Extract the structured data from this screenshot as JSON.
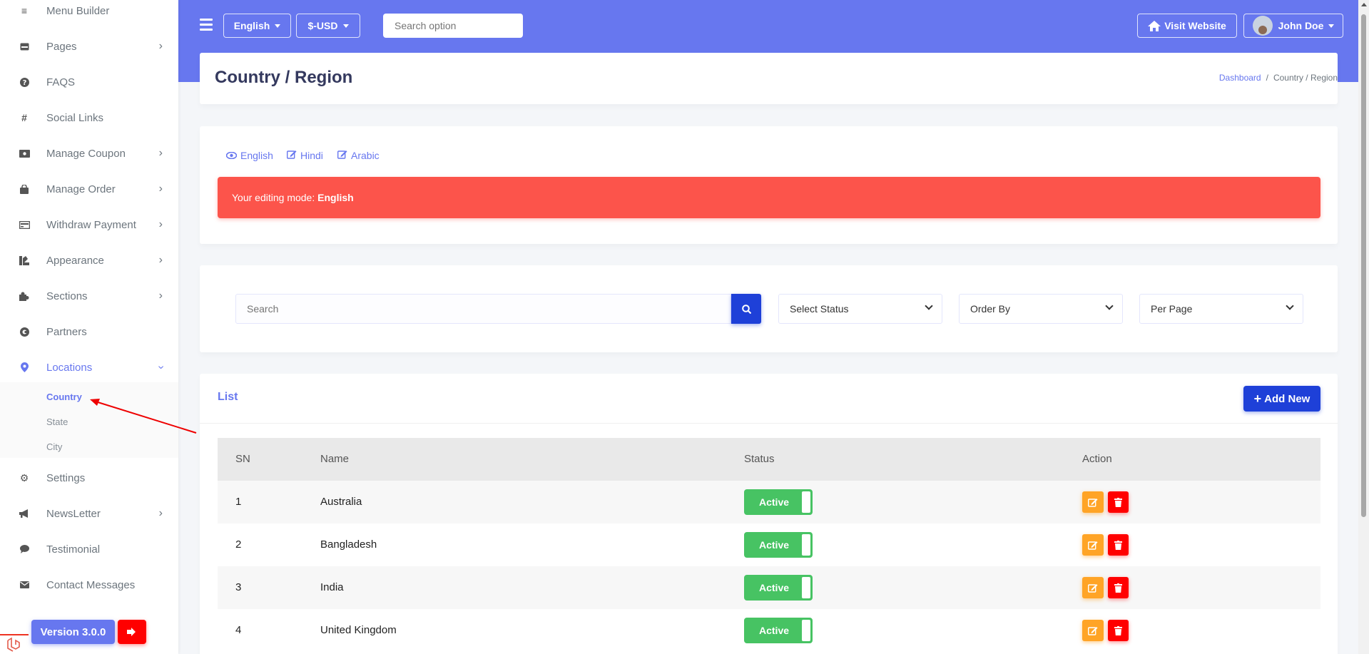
{
  "sidebar": {
    "items": [
      {
        "label": "Menu Builder",
        "icon": "bars-icon",
        "chevron": false
      },
      {
        "label": "Pages",
        "icon": "page-icon",
        "chevron": true
      },
      {
        "label": "FAQS",
        "icon": "question-icon",
        "chevron": false
      },
      {
        "label": "Social Links",
        "icon": "hashtag-icon",
        "chevron": false
      },
      {
        "label": "Manage Coupon",
        "icon": "ticket-icon",
        "chevron": true
      },
      {
        "label": "Manage Order",
        "icon": "bag-icon",
        "chevron": true
      },
      {
        "label": "Withdraw Payment",
        "icon": "card-icon",
        "chevron": true
      },
      {
        "label": "Appearance",
        "icon": "paint-icon",
        "chevron": true
      },
      {
        "label": "Sections",
        "icon": "puzzle-icon",
        "chevron": true
      },
      {
        "label": "Partners",
        "icon": "partner-icon",
        "chevron": false
      },
      {
        "label": "Locations",
        "icon": "location-pin-icon",
        "chevron": true
      },
      {
        "label": "Settings",
        "icon": "gear-icon",
        "chevron": false
      },
      {
        "label": "NewsLetter",
        "icon": "megaphone-icon",
        "chevron": true
      },
      {
        "label": "Testimonial",
        "icon": "comment-icon",
        "chevron": false
      },
      {
        "label": "Contact Messages",
        "icon": "envelope-icon",
        "chevron": false
      }
    ],
    "submenu": [
      "Country",
      "State",
      "City"
    ],
    "version": "Version 3.0.0"
  },
  "topbar": {
    "language": "English",
    "currency": "$-USD",
    "search_placeholder": "Search option",
    "visit_website": "Visit Website",
    "user_name": "John Doe"
  },
  "header": {
    "title": "Country / Region",
    "breadcrumb": [
      "Dashboard",
      "Country / Region"
    ]
  },
  "languages": {
    "tabs": [
      "English",
      "Hindi",
      "Arabic"
    ],
    "alert_prefix": "Your editing mode: ",
    "alert_lang": "English"
  },
  "filters": {
    "search_placeholder": "Search",
    "status": "Select Status",
    "order_by": "Order By",
    "per_page": "Per Page"
  },
  "list": {
    "title": "List",
    "add_new": "Add New",
    "columns": [
      "SN",
      "Name",
      "Status",
      "Action"
    ],
    "rows": [
      {
        "sn": "1",
        "name": "Australia",
        "status": "Active"
      },
      {
        "sn": "2",
        "name": "Bangladesh",
        "status": "Active"
      },
      {
        "sn": "3",
        "name": "India",
        "status": "Active"
      },
      {
        "sn": "4",
        "name": "United Kingdom",
        "status": "Active"
      }
    ]
  },
  "colors": {
    "primary": "#6777ef",
    "button_blue": "#1e40d8",
    "success": "#47c363",
    "danger": "#fc544b",
    "warning": "#ffa426"
  }
}
